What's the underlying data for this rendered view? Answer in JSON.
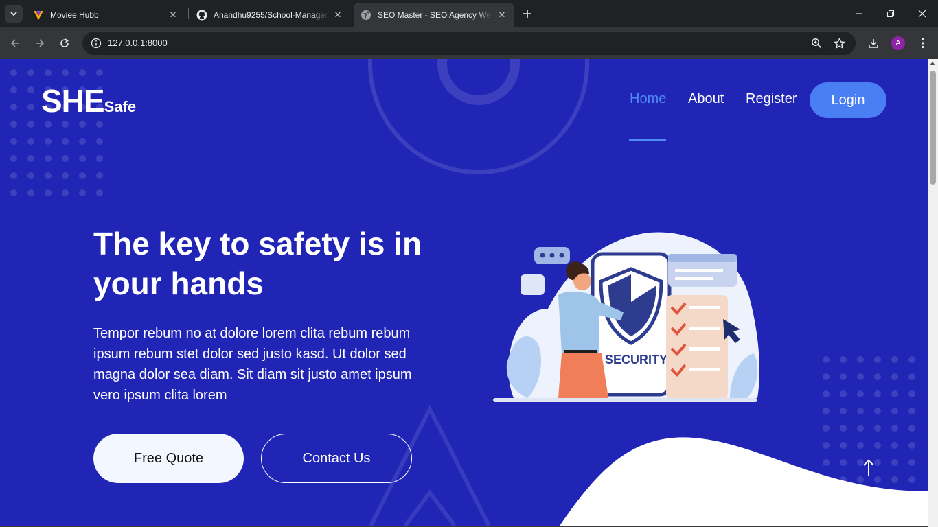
{
  "browser": {
    "tabs": [
      {
        "title": "Moviee Hubb",
        "icon": "moviee-hubb-icon"
      },
      {
        "title": "Anandhu9255/School-Management",
        "icon": "github-icon"
      },
      {
        "title": "SEO Master - SEO Agency Website",
        "icon": "globe-icon"
      }
    ],
    "address": "127.0.0.1:8000",
    "profile_initial": "A"
  },
  "page": {
    "brand": {
      "main": "SHE",
      "sub": "Safe"
    },
    "nav": [
      {
        "label": "Home",
        "active": true
      },
      {
        "label": "About",
        "active": false
      },
      {
        "label": "Register",
        "active": false
      }
    ],
    "login_label": "Login",
    "hero": {
      "title": "The key to safety is in your hands",
      "text": "Tempor rebum no at dolore lorem clita rebum rebum ipsum rebum stet dolor sed justo kasd. Ut dolor sed magna dolor sea diam. Sit diam sit justo amet ipsum vero ipsum clita lorem",
      "btn_primary": "Free Quote",
      "btn_secondary": "Contact Us"
    },
    "illustration": {
      "label": "SECURITY"
    },
    "colors": {
      "background": "#2125b6",
      "accent": "#4a7ff3",
      "active_link": "#4d8bf5"
    }
  }
}
